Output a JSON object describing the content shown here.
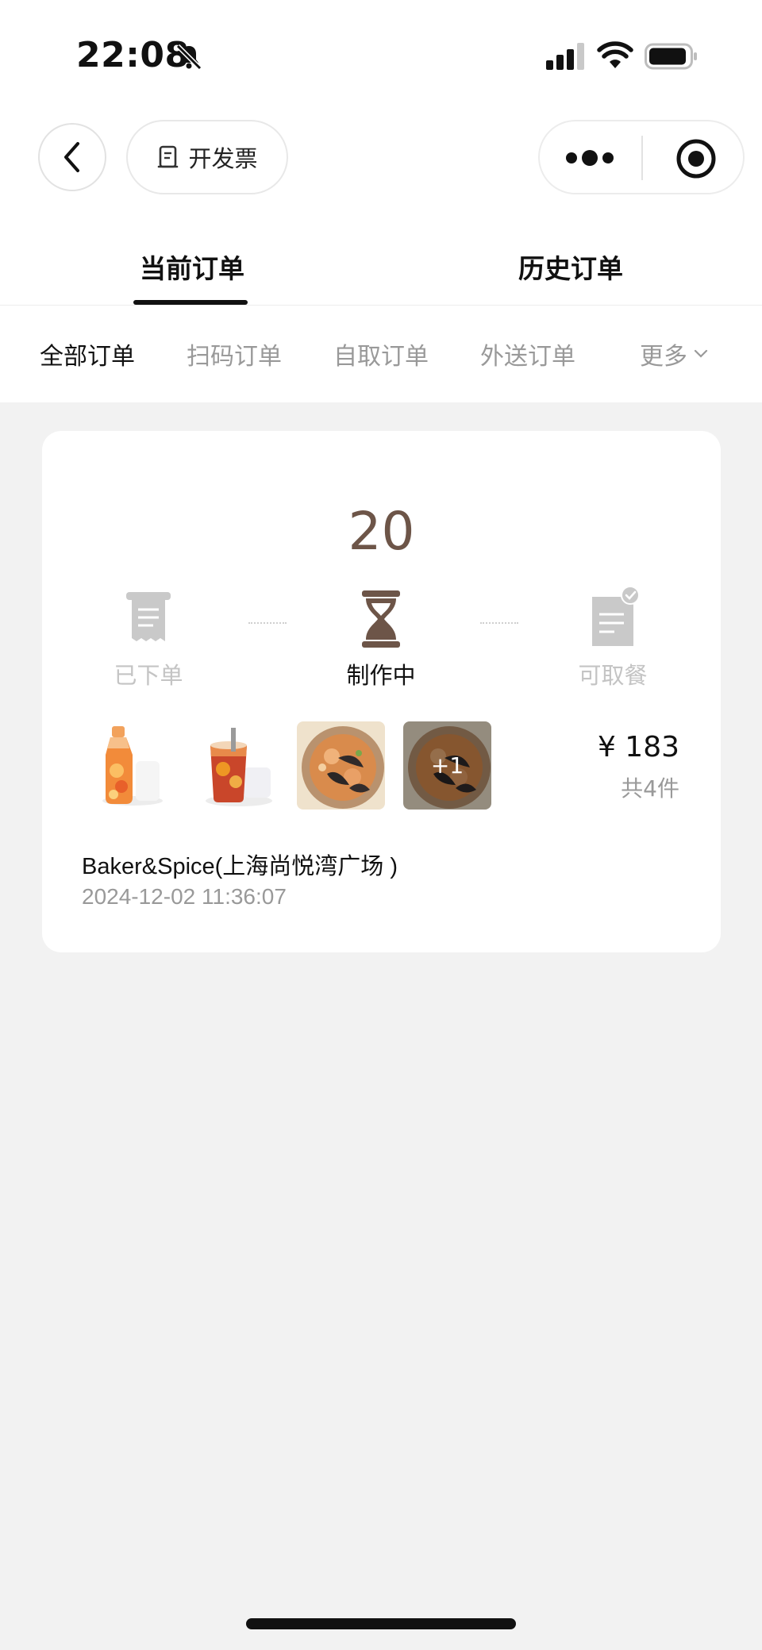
{
  "status_bar": {
    "time": "22:08",
    "icons": [
      "bell-slash-icon",
      "cellular-signal-icon",
      "wifi-icon",
      "battery-icon"
    ]
  },
  "nav": {
    "back_icon": "chevron-left-icon",
    "invoice_icon": "receipt-icon",
    "invoice_label": "开发票",
    "more_icon": "more-dots-icon",
    "close_icon": "target-circle-icon"
  },
  "tabs": [
    {
      "label": "当前订单",
      "active": true
    },
    {
      "label": "历史订单",
      "active": false
    }
  ],
  "filters": [
    {
      "label": "全部订单",
      "active": true
    },
    {
      "label": "扫码订单",
      "active": false
    },
    {
      "label": "自取订单",
      "active": false
    },
    {
      "label": "外送订单",
      "active": false
    },
    {
      "label": "更多",
      "active": false,
      "icon": "chevron-down-icon"
    }
  ],
  "order": {
    "queue_number": "20",
    "steps": [
      {
        "label": "已下单",
        "icon": "receipt-icon",
        "active": false
      },
      {
        "label": "制作中",
        "icon": "hourglass-icon",
        "active": true
      },
      {
        "label": "可取餐",
        "icon": "document-check-icon",
        "active": false
      }
    ],
    "items": [
      {
        "name": "fruit-tea-carafe-thumbnail"
      },
      {
        "name": "iced-tea-glass-thumbnail"
      },
      {
        "name": "seafood-pasta-thumbnail"
      },
      {
        "name": "seafood-pasta-thumbnail-more",
        "overlay": "+1"
      }
    ],
    "price": "¥ 183",
    "count": "共4件",
    "store": "Baker&Spice(上海尚悦湾广场 )",
    "time": "2024-12-02 11:36:07"
  },
  "colors": {
    "accent_brown": "#6d5548",
    "page_background": "#f2f2f2",
    "muted_text": "#999999",
    "inactive_step": "#c4c4c4"
  }
}
